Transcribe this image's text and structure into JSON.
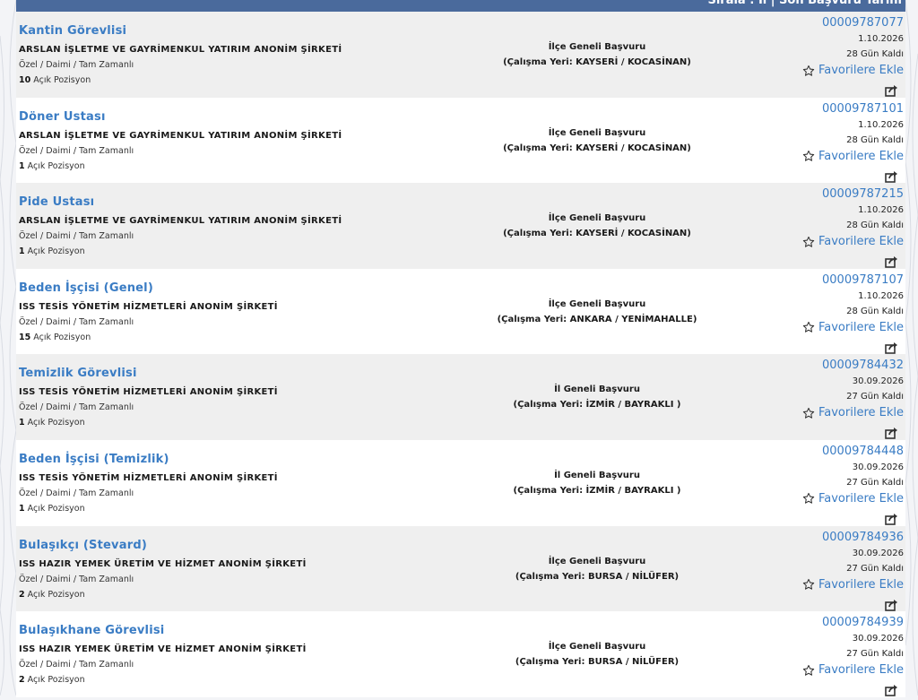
{
  "header": {
    "label": "Sırala : İl | Son Başvuru Tarihi"
  },
  "listings": [
    {
      "title": "Kantin Görevlisi",
      "company": "ARSLAN İŞLETME VE GAYRİMENKUL YATIRIM ANONİM ŞİRKETİ",
      "type": "Özel / Daimi / Tam Zamanlı",
      "count": "10",
      "count_label": "Açık Pozisyon",
      "scope": "İlçe Geneli Başvuru",
      "location": "(Çalışma Yeri: KAYSERİ / KOCASİNAN)",
      "ilan_no": "00009787077",
      "date": "1.10.2026",
      "remaining": "28 Gün Kaldı",
      "fav_label": "Favorilere Ekle"
    },
    {
      "title": "Döner Ustası",
      "company": "ARSLAN İŞLETME VE GAYRİMENKUL YATIRIM ANONİM ŞİRKETİ",
      "type": "Özel / Daimi / Tam Zamanlı",
      "count": "1",
      "count_label": "Açık Pozisyon",
      "scope": "İlçe Geneli Başvuru",
      "location": "(Çalışma Yeri: KAYSERİ / KOCASİNAN)",
      "ilan_no": "00009787101",
      "date": "1.10.2026",
      "remaining": "28 Gün Kaldı",
      "fav_label": "Favorilere Ekle"
    },
    {
      "title": "Pide Ustası",
      "company": "ARSLAN İŞLETME VE GAYRİMENKUL YATIRIM ANONİM ŞİRKETİ",
      "type": "Özel / Daimi / Tam Zamanlı",
      "count": "1",
      "count_label": "Açık Pozisyon",
      "scope": "İlçe Geneli Başvuru",
      "location": "(Çalışma Yeri: KAYSERİ / KOCASİNAN)",
      "ilan_no": "00009787215",
      "date": "1.10.2026",
      "remaining": "28 Gün Kaldı",
      "fav_label": "Favorilere Ekle"
    },
    {
      "title": "Beden İşçisi (Genel)",
      "company": "ISS TESİS YÖNETİM HİZMETLERİ ANONİM ŞİRKETİ",
      "type": "Özel / Daimi / Tam Zamanlı",
      "count": "15",
      "count_label": "Açık Pozisyon",
      "scope": "İlçe Geneli Başvuru",
      "location": "(Çalışma Yeri: ANKARA / YENİMAHALLE)",
      "ilan_no": "00009787107",
      "date": "1.10.2026",
      "remaining": "28 Gün Kaldı",
      "fav_label": "Favorilere Ekle"
    },
    {
      "title": "Temizlik Görevlisi",
      "company": "ISS TESİS YÖNETİM HİZMETLERİ ANONİM ŞİRKETİ",
      "type": "Özel / Daimi / Tam Zamanlı",
      "count": "1",
      "count_label": "Açık Pozisyon",
      "scope": "İl Geneli Başvuru",
      "location": "(Çalışma Yeri: İZMİR / BAYRAKLI )",
      "ilan_no": "00009784432",
      "date": "30.09.2026",
      "remaining": "27 Gün Kaldı",
      "fav_label": "Favorilere Ekle"
    },
    {
      "title": "Beden İşçisi (Temizlik)",
      "company": "ISS TESİS YÖNETİM HİZMETLERİ ANONİM ŞİRKETİ",
      "type": "Özel / Daimi / Tam Zamanlı",
      "count": "1",
      "count_label": "Açık Pozisyon",
      "scope": "İl Geneli Başvuru",
      "location": "(Çalışma Yeri: İZMİR / BAYRAKLI )",
      "ilan_no": "00009784448",
      "date": "30.09.2026",
      "remaining": "27 Gün Kaldı",
      "fav_label": "Favorilere Ekle"
    },
    {
      "title": "Bulaşıkçı (Stevard)",
      "company": "ISS HAZIR YEMEK ÜRETİM VE HİZMET ANONİM ŞİRKETİ",
      "type": "Özel / Daimi / Tam Zamanlı",
      "count": "2",
      "count_label": "Açık Pozisyon",
      "scope": "İlçe Geneli Başvuru",
      "location": "(Çalışma Yeri: BURSA / NİLÜFER)",
      "ilan_no": "00009784936",
      "date": "30.09.2026",
      "remaining": "27 Gün Kaldı",
      "fav_label": "Favorilere Ekle"
    },
    {
      "title": "Bulaşıkhane Görevlisi",
      "company": "ISS HAZIR YEMEK ÜRETİM VE HİZMET ANONİM ŞİRKETİ",
      "type": "Özel / Daimi / Tam Zamanlı",
      "count": "2",
      "count_label": "Açık Pozisyon",
      "scope": "İlçe Geneli Başvuru",
      "location": "(Çalışma Yeri: BURSA / NİLÜFER)",
      "ilan_no": "00009784939",
      "date": "30.09.2026",
      "remaining": "27 Gün Kaldı",
      "fav_label": "Favorilere Ekle"
    }
  ],
  "icons": {
    "favorite": "star-outline-icon",
    "share": "share-icon"
  },
  "colors": {
    "link": "#3a7cc4",
    "header_bg": "#4a6a9c",
    "row_odd": "#efefef",
    "row_even": "#ffffff"
  }
}
